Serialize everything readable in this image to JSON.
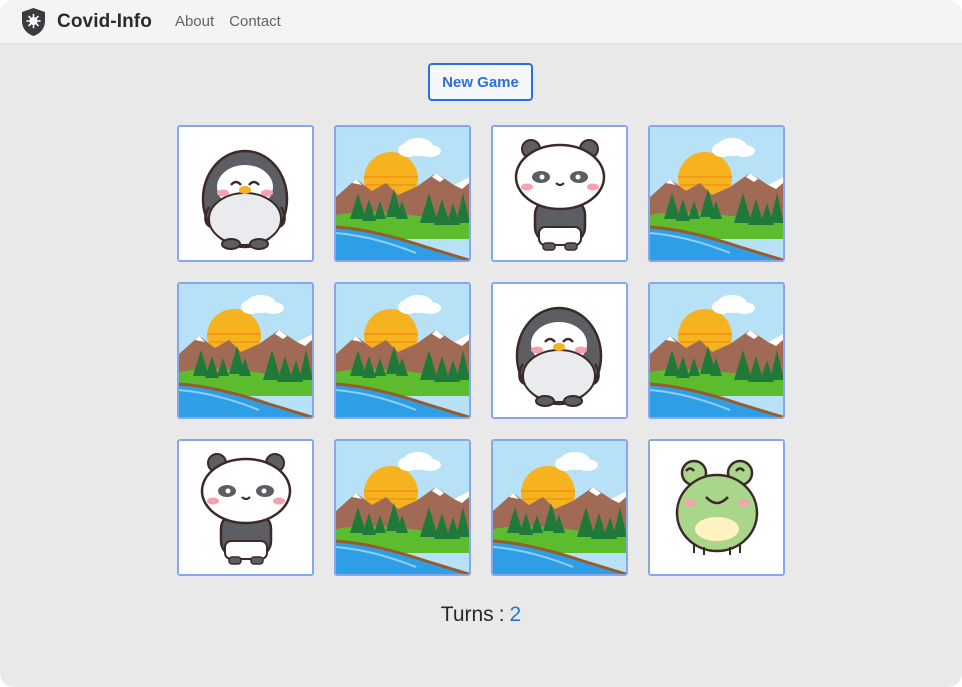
{
  "navbar": {
    "brand": "Covid-Info",
    "logo_icon": "virus-shield-icon",
    "links": [
      {
        "label": "About"
      },
      {
        "label": "Contact"
      }
    ]
  },
  "game": {
    "new_game_label": "New Game",
    "turns_label": "Turns",
    "turns_separator": ":",
    "turns_value": "2",
    "accent": "#2b6fd9",
    "cards": [
      {
        "state": "face-up",
        "image": "penguin"
      },
      {
        "state": "face-down",
        "image": "landscape-card-back"
      },
      {
        "state": "face-up",
        "image": "panda"
      },
      {
        "state": "face-down",
        "image": "landscape-card-back"
      },
      {
        "state": "face-down",
        "image": "landscape-card-back"
      },
      {
        "state": "face-down",
        "image": "landscape-card-back"
      },
      {
        "state": "face-up",
        "image": "penguin"
      },
      {
        "state": "face-down",
        "image": "landscape-card-back"
      },
      {
        "state": "face-up",
        "image": "panda"
      },
      {
        "state": "face-down",
        "image": "landscape-card-back"
      },
      {
        "state": "face-down",
        "image": "landscape-card-back"
      },
      {
        "state": "face-up",
        "image": "frog"
      }
    ]
  }
}
